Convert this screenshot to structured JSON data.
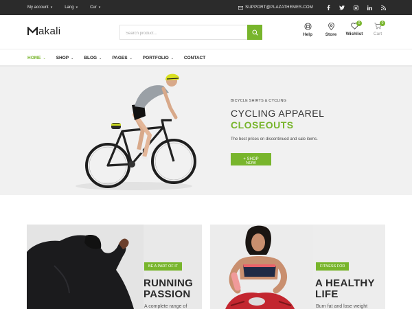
{
  "topbar": {
    "account": "My account",
    "lang": "Lang",
    "cur": "Cur",
    "support": "SUPPORT@PLAZATHEMES.COM",
    "social": [
      "facebook-icon",
      "twitter-icon",
      "instagram-icon",
      "linkedin-icon",
      "rss-icon"
    ]
  },
  "header": {
    "logo": "akali",
    "search_placeholder": "Search product...",
    "icons": {
      "help": "Help",
      "store": "Store",
      "wishlist": "Wishlist",
      "cart": "Cart"
    },
    "wishlist_count": "0",
    "cart_count": "0"
  },
  "nav": {
    "items": [
      {
        "label": "HOME",
        "dropdown": true
      },
      {
        "label": "SHOP",
        "dropdown": true
      },
      {
        "label": "BLOG",
        "dropdown": true
      },
      {
        "label": "PAGES",
        "dropdown": true
      },
      {
        "label": "PORTFOLIO",
        "dropdown": true
      },
      {
        "label": "CONTACT",
        "dropdown": false
      }
    ]
  },
  "hero": {
    "subtitle": "BICYCLE SHIRTS & CYCLING",
    "title1": "CYCLING APPAREL",
    "title2": "CLOSEOUTS",
    "desc": "The best prices on discontinued and sale items.",
    "button": "+ SHOP NOW"
  },
  "banners": [
    {
      "tag": "BE A PART OF IT",
      "title1": "RUNNING",
      "title2": "PASSION",
      "desc": "A complete range of"
    },
    {
      "tag": "FITNESS FOR",
      "title1": "A HEALTHY",
      "title2": "LIFE",
      "desc": "Burn fat and lose weight"
    }
  ],
  "colors": {
    "accent": "#78b52c",
    "topbar": "#2b2b2b"
  }
}
